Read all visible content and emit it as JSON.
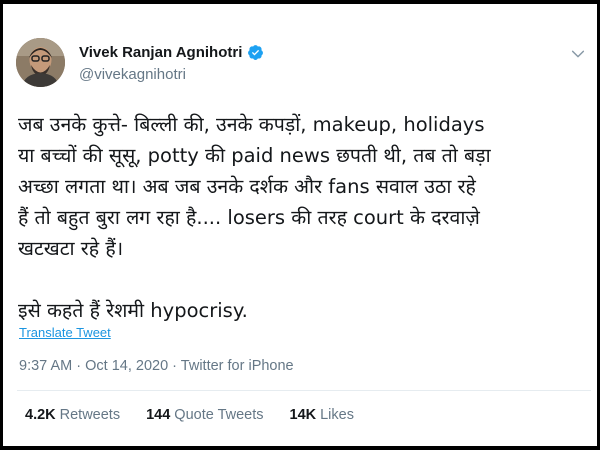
{
  "tweet": {
    "author": {
      "name": "Vivek Ranjan Agnihotri",
      "handle": "@vivekagnihotri",
      "verified": true
    },
    "text_lines": [
      "जब उनके कुत्ते- बिल्ली की, उनके कपड़ों, makeup, holidays",
      "या बच्चों की सूसू, potty की paid news छपती थी, तब तो बड़ा",
      "अच्छा लगता था। अब जब उनके दर्शक और fans सवाल उठा रहे",
      "हैं तो बहुत बुरा लग रहा है.... losers की तरह court के दरवाज़े",
      "खटखटा रहे हैं।",
      "इसे कहते हैं रेशमी hypocrisy."
    ],
    "translate_label": "Translate Tweet",
    "time": "9:37 AM",
    "separator": "·",
    "date": "Oct 14, 2020",
    "source": "Twitter for iPhone",
    "stats": {
      "retweets_count": "4.2K",
      "retweets_label": "Retweets",
      "quotes_count": "144",
      "quotes_label": "Quote Tweets",
      "likes_count": "14K",
      "likes_label": "Likes"
    }
  },
  "colors": {
    "link": "#1b95e0",
    "verified": "#1da1f2",
    "muted": "#657786",
    "text": "#14171a"
  },
  "icons": [
    "verified-badge-icon",
    "chevron-down-icon"
  ]
}
